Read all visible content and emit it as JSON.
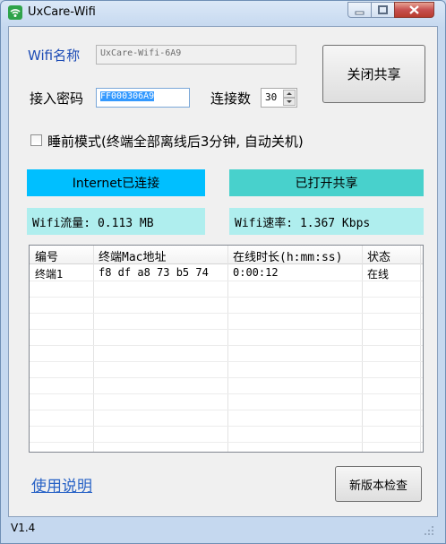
{
  "window": {
    "title": "UxCare-Wifi"
  },
  "form": {
    "wifi_name_label": "Wifi名称",
    "wifi_name_value": "UxCare-Wifi-6A9",
    "password_label": "接入密码",
    "password_value": "FF000306A9",
    "connections_label": "连接数",
    "connections_value": "30",
    "sleep_mode_label": "睡前模式(终端全部离线后3分钟, 自动关机)",
    "sleep_mode_checked": false
  },
  "buttons": {
    "share": "关闭共享",
    "update": "新版本检查"
  },
  "status": {
    "internet": "Internet已连接",
    "sharing": "已打开共享",
    "traffic": "Wifi流量: 0.113 MB",
    "speed": "Wifi速率: 1.367 Kbps"
  },
  "colors": {
    "internet_bg": "#00bfff",
    "sharing_bg": "#48d1cc",
    "info_bg": "#afeeee"
  },
  "table": {
    "headers": [
      "编号",
      "终端Mac地址",
      "在线时长(h:mm:ss)",
      "状态"
    ],
    "rows": [
      [
        "终端1",
        "f8 df a8 73 b5 74",
        "0:00:12",
        "在线"
      ]
    ]
  },
  "footer": {
    "help_link": "使用说明",
    "version": "V1.4"
  }
}
